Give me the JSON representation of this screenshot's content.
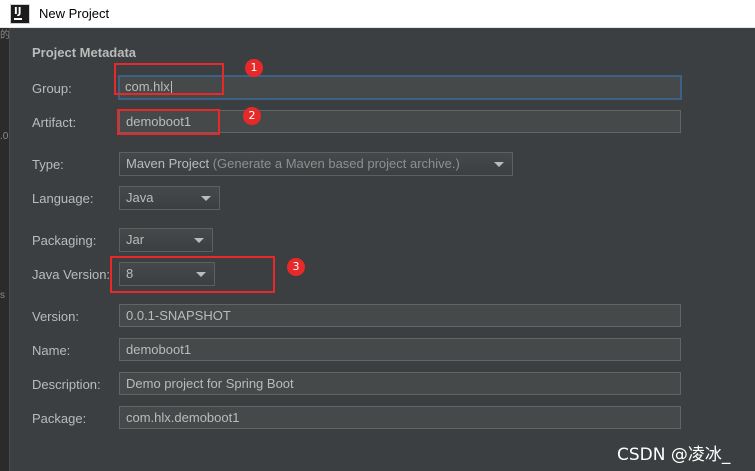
{
  "window": {
    "title": "New Project",
    "icon_text": "IJ"
  },
  "left_strip": {
    "text_1": "的",
    "text_2": ".0",
    "text_3": "s"
  },
  "metadata": {
    "section_title": "Project Metadata",
    "group": {
      "label": "Group:",
      "value": "com.hlx"
    },
    "artifact": {
      "label": "Artifact:",
      "value": "demoboot1"
    },
    "type": {
      "label": "Type:",
      "value": "Maven Project",
      "hint": "(Generate a Maven based project archive.)"
    },
    "language": {
      "label": "Language:",
      "value": "Java"
    },
    "packaging": {
      "label": "Packaging:",
      "value": "Jar"
    },
    "java_version": {
      "label": "Java Version:",
      "value": "8"
    },
    "version": {
      "label": "Version:",
      "value": "0.0.1-SNAPSHOT"
    },
    "name": {
      "label": "Name:",
      "value": "demoboot1"
    },
    "description": {
      "label": "Description:",
      "value": "Demo project for Spring Boot"
    },
    "package": {
      "label": "Package:",
      "value": "com.hlx.demoboot1"
    }
  },
  "annotations": [
    {
      "number": "1"
    },
    {
      "number": "2"
    },
    {
      "number": "3"
    }
  ],
  "watermark": "CSDN @凌冰_",
  "colors": {
    "annotation": "#e8292a",
    "focus_border": "#3d6185",
    "background": "#3c3f41"
  }
}
